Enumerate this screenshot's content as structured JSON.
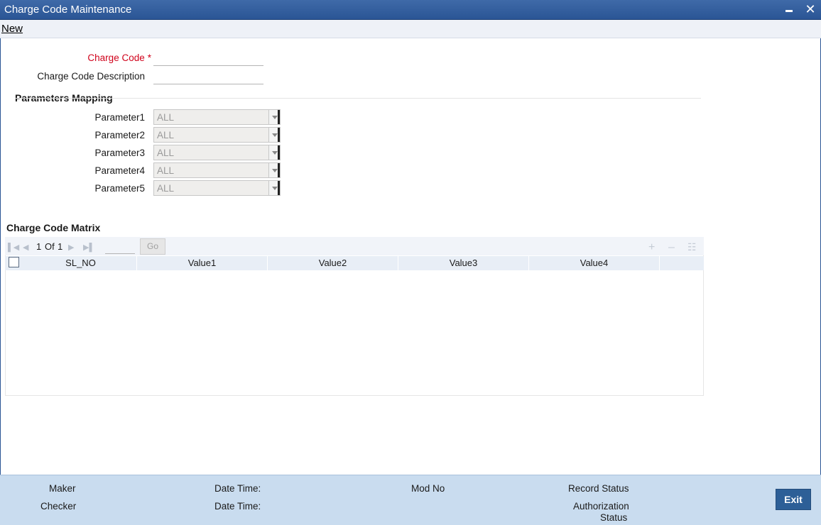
{
  "window": {
    "title": "Charge Code Maintenance",
    "minimize_icon": "minimize-icon",
    "close_icon": "close-icon"
  },
  "toolbar": {
    "new_label": "New"
  },
  "form": {
    "charge_code_label": "Charge Code",
    "required_marker": "*",
    "charge_code_value": "",
    "charge_code_description_label": "Charge Code Description",
    "charge_code_description_value": ""
  },
  "parameters_mapping": {
    "title": "Parameters Mapping",
    "params": [
      {
        "label": "Parameter1",
        "value": "ALL"
      },
      {
        "label": "Parameter2",
        "value": "ALL"
      },
      {
        "label": "Parameter3",
        "value": "ALL"
      },
      {
        "label": "Parameter4",
        "value": "ALL"
      },
      {
        "label": "Parameter5",
        "value": "ALL"
      }
    ]
  },
  "matrix": {
    "title": "Charge Code Matrix",
    "pager": {
      "current": "1",
      "of_label": "Of",
      "total": "1",
      "go_label": "Go"
    },
    "columns": [
      "SL_NO",
      "Value1",
      "Value2",
      "Value3",
      "Value4"
    ],
    "rows": []
  },
  "footer": {
    "maker_label": "Maker",
    "checker_label": "Checker",
    "maker_date_time_label": "Date Time:",
    "checker_date_time_label": "Date Time:",
    "mod_no_label": "Mod No",
    "record_status_label": "Record Status",
    "authorization_status_label_line1": "Authorization",
    "authorization_status_label_line2": "Status",
    "exit_label": "Exit"
  },
  "colors": {
    "title_bar": "#2a5595",
    "required_label": "#d0021b",
    "footer_bg": "#c9dcef",
    "exit_button": "#2d5f97"
  }
}
